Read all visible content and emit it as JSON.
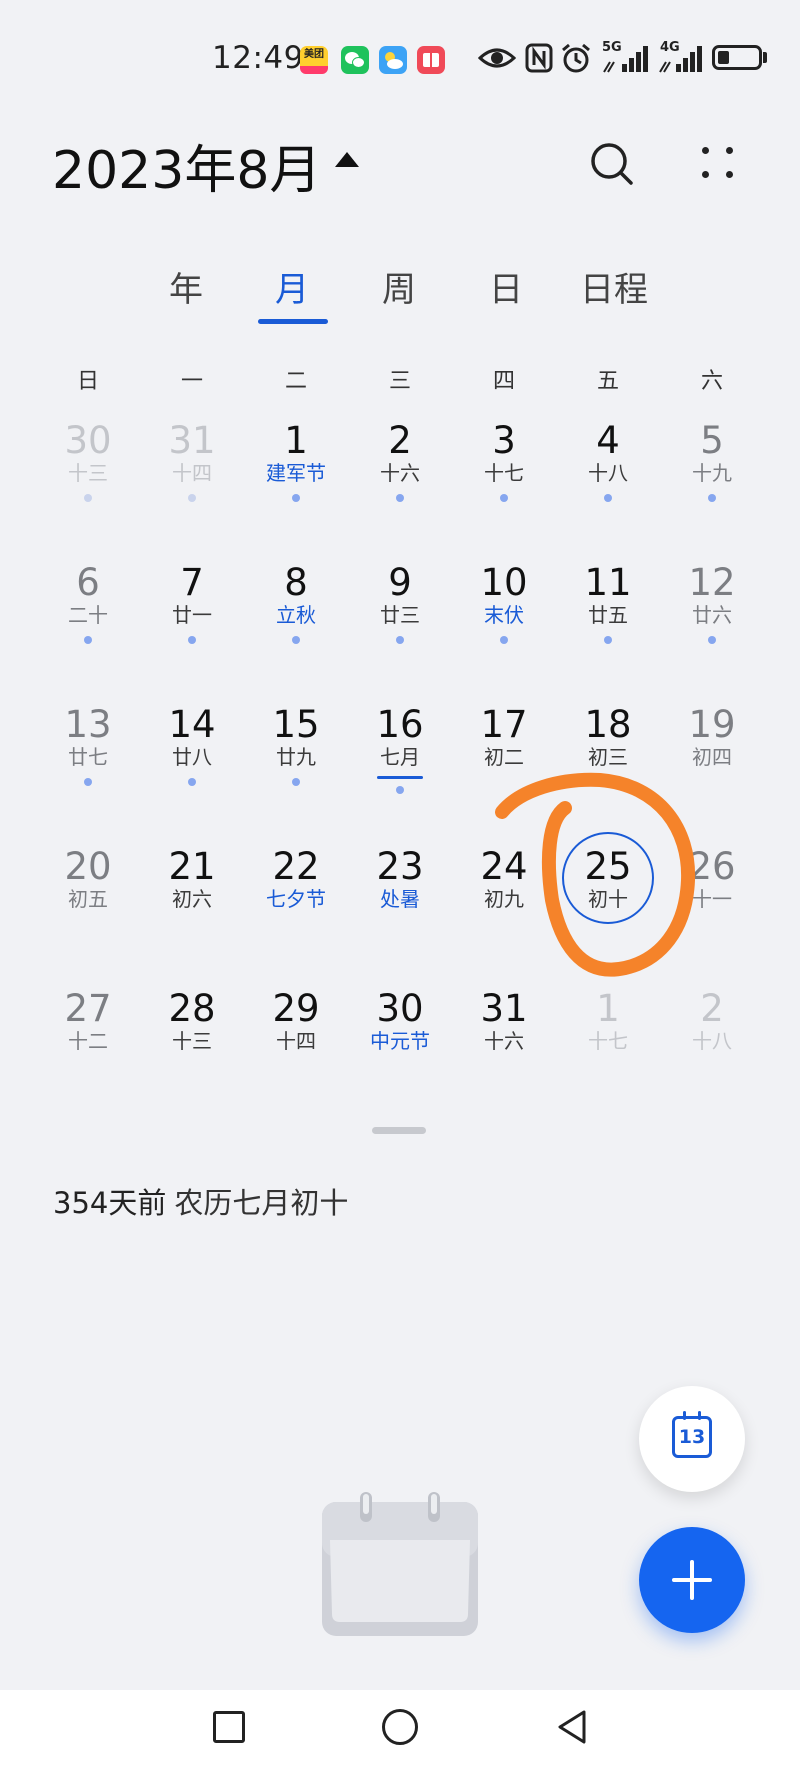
{
  "status_bar": {
    "time": "12:49",
    "apps": [
      "meituan-icon",
      "wechat-icon",
      "weather-icon",
      "reader-icon"
    ],
    "meituan_label": "美团",
    "network_1": "5G",
    "network_2": "4G"
  },
  "header": {
    "title": "2023年8月"
  },
  "tabs": [
    {
      "label": "年"
    },
    {
      "label": "月"
    },
    {
      "label": "周"
    },
    {
      "label": "日"
    },
    {
      "label": "日程"
    }
  ],
  "weekdays": [
    "日",
    "一",
    "二",
    "三",
    "四",
    "五",
    "六"
  ],
  "weeks": [
    [
      {
        "num": "30",
        "lunar": "十三",
        "other": true,
        "dot": true
      },
      {
        "num": "31",
        "lunar": "十四",
        "other": true,
        "dot": true
      },
      {
        "num": "1",
        "lunar": "建军节",
        "festival": true,
        "dot": true
      },
      {
        "num": "2",
        "lunar": "十六",
        "dot": true
      },
      {
        "num": "3",
        "lunar": "十七",
        "dot": true
      },
      {
        "num": "4",
        "lunar": "十八",
        "dot": true
      },
      {
        "num": "5",
        "lunar": "十九",
        "dot": true
      }
    ],
    [
      {
        "num": "6",
        "lunar": "二十",
        "dot": true
      },
      {
        "num": "7",
        "lunar": "廿一",
        "dot": true
      },
      {
        "num": "8",
        "lunar": "立秋",
        "festival": true,
        "dot": true
      },
      {
        "num": "9",
        "lunar": "廿三",
        "dot": true
      },
      {
        "num": "10",
        "lunar": "末伏",
        "festival": true,
        "dot": true
      },
      {
        "num": "11",
        "lunar": "廿五",
        "dot": true
      },
      {
        "num": "12",
        "lunar": "廿六",
        "dot": true
      }
    ],
    [
      {
        "num": "13",
        "lunar": "廿七",
        "dot": true
      },
      {
        "num": "14",
        "lunar": "廿八",
        "dot": true
      },
      {
        "num": "15",
        "lunar": "廿九",
        "dot": true
      },
      {
        "num": "16",
        "lunar": "七月",
        "dot": true,
        "underline": true
      },
      {
        "num": "17",
        "lunar": "初二"
      },
      {
        "num": "18",
        "lunar": "初三"
      },
      {
        "num": "19",
        "lunar": "初四"
      }
    ],
    [
      {
        "num": "20",
        "lunar": "初五"
      },
      {
        "num": "21",
        "lunar": "初六"
      },
      {
        "num": "22",
        "lunar": "七夕节",
        "festival": true
      },
      {
        "num": "23",
        "lunar": "处暑",
        "festival": true
      },
      {
        "num": "24",
        "lunar": "初九"
      },
      {
        "num": "25",
        "lunar": "初十",
        "today": true
      },
      {
        "num": "26",
        "lunar": "十一"
      }
    ],
    [
      {
        "num": "27",
        "lunar": "十二"
      },
      {
        "num": "28",
        "lunar": "十三"
      },
      {
        "num": "29",
        "lunar": "十四"
      },
      {
        "num": "30",
        "lunar": "中元节",
        "festival": true
      },
      {
        "num": "31",
        "lunar": "十六"
      },
      {
        "num": "1",
        "lunar": "十七",
        "other": true
      },
      {
        "num": "2",
        "lunar": "十八",
        "other": true
      }
    ]
  ],
  "info": {
    "relative": "354天前",
    "lunar": "农历七月初十"
  },
  "fab_today": {
    "day": "13"
  },
  "colors": {
    "accent": "#1a5bd6",
    "fab": "#1565f0",
    "annotation": "#f5832a"
  }
}
